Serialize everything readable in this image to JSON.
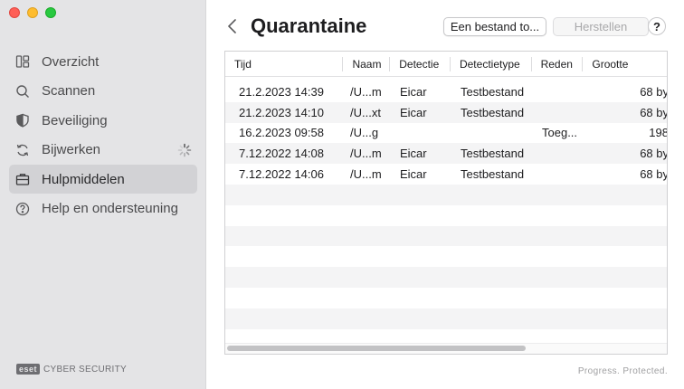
{
  "sidebar": {
    "items": [
      {
        "label": "Overzicht",
        "icon": "dashboard-icon"
      },
      {
        "label": "Scannen",
        "icon": "search-icon"
      },
      {
        "label": "Beveiliging",
        "icon": "shield-icon"
      },
      {
        "label": "Bijwerken",
        "icon": "refresh-icon"
      },
      {
        "label": "Hulpmiddelen",
        "icon": "briefcase-icon",
        "active": true
      },
      {
        "label": "Help en ondersteuning",
        "icon": "help-circle-icon"
      }
    ],
    "brand_logo": "eset",
    "brand_text": "CYBER SECURITY"
  },
  "header": {
    "title": "Quarantaine",
    "primary_button": "Een bestand to...",
    "secondary_button": "Herstellen",
    "help_button": "?"
  },
  "table": {
    "columns": [
      "Tijd",
      "Naam",
      "Detectie",
      "Detectietype",
      "Reden",
      "Grootte"
    ],
    "rows": [
      [
        "21.2.2023 14:39",
        "/U...m",
        "Eicar",
        "Testbestand",
        "",
        "68 by"
      ],
      [
        "21.2.2023 14:10",
        "/U...xt",
        "Eicar",
        "Testbestand",
        "",
        "68 by"
      ],
      [
        "16.2.2023 09:58",
        "/U...g",
        "",
        "",
        "Toeg...",
        "198"
      ],
      [
        "7.12.2022 14:08",
        "/U...m",
        "Eicar",
        "Testbestand",
        "",
        "68 by"
      ],
      [
        "7.12.2022 14:06",
        "/U...m",
        "Eicar",
        "Testbestand",
        "",
        "68 by"
      ]
    ]
  },
  "footer": {
    "tagline": "Progress. Protected."
  },
  "colors": {
    "sidebar_bg": "#e4e4e6",
    "active_item_bg": "#d2d2d5",
    "row_stripe": "#f4f4f5"
  }
}
